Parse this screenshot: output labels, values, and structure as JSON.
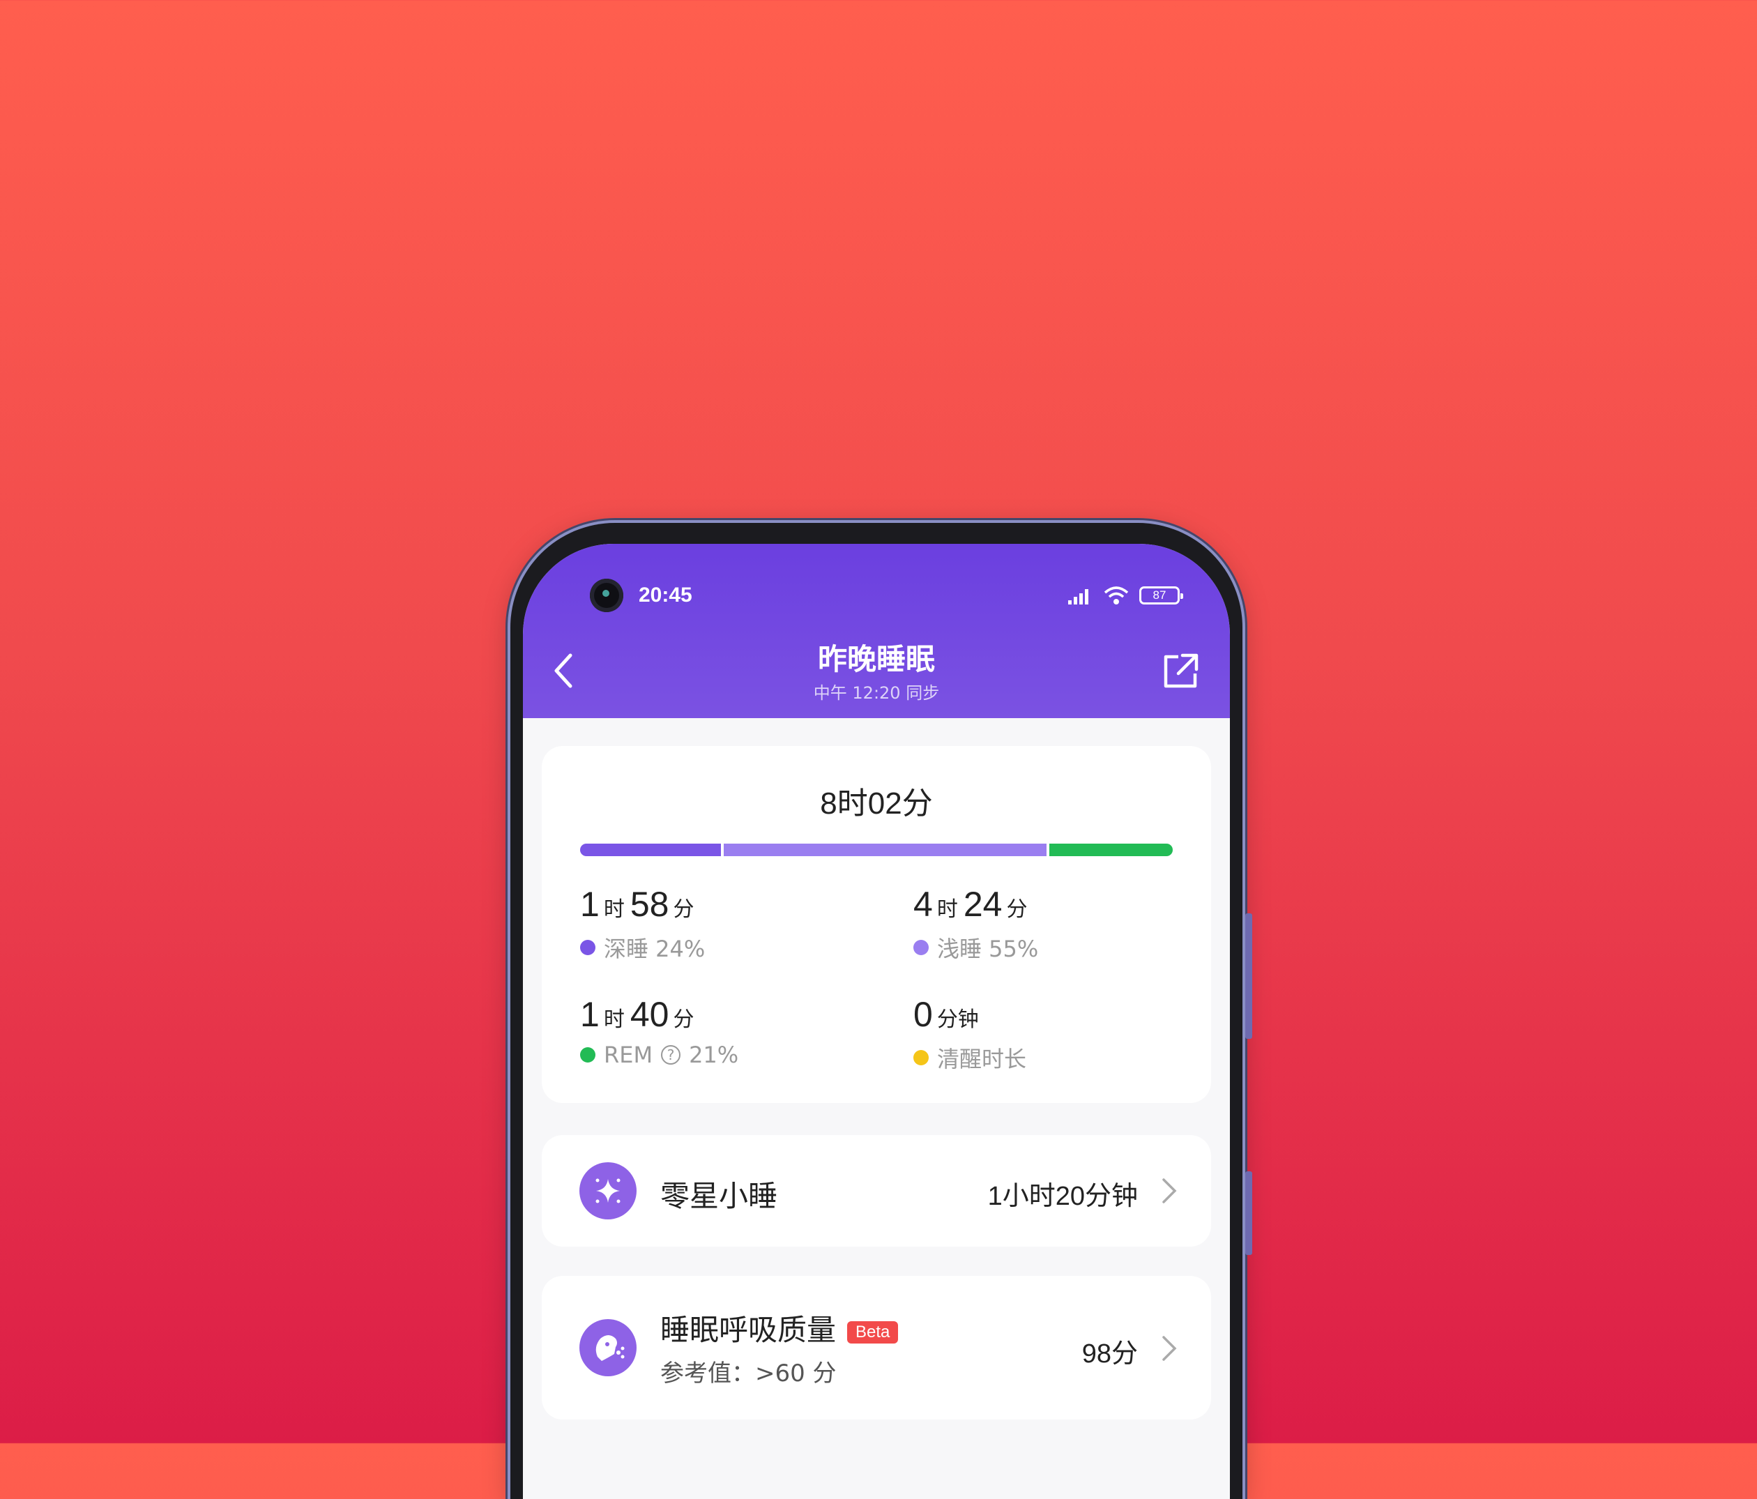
{
  "status_bar": {
    "time": "20:45",
    "battery": "87"
  },
  "header": {
    "title": "昨晚睡眠",
    "subtitle": "中午 12:20 同步"
  },
  "summary": {
    "total": "8时02分",
    "bar_fractions": {
      "deep": 0.24,
      "light": 0.55,
      "rem": 0.21
    },
    "stats": [
      {
        "h": "1",
        "hu": "时",
        "m": "58",
        "mu": "分",
        "label": "深睡 24%",
        "color": "#7a55e6"
      },
      {
        "h": "4",
        "hu": "时",
        "m": "24",
        "mu": "分",
        "label": "浅睡 55%",
        "color": "#9a7ef0"
      },
      {
        "h": "1",
        "hu": "时",
        "m": "40",
        "mu": "分",
        "label_a": "REM",
        "label_b": "21%",
        "color": "#22bb55"
      },
      {
        "h": "0",
        "hu": "分钟",
        "label": "清醒时长",
        "color": "#f5c518"
      }
    ]
  },
  "nap": {
    "title": "零星小睡",
    "value": "1小时20分钟"
  },
  "breathing": {
    "title": "睡眠呼吸质量",
    "badge": "Beta",
    "reference": "参考值：>60 分",
    "value": "98分"
  },
  "colors": {
    "header": "#6b3fe0",
    "accent": "#7a55e6",
    "rem": "#22bb55",
    "awake": "#f5c518",
    "badge": "#f24a4a"
  }
}
